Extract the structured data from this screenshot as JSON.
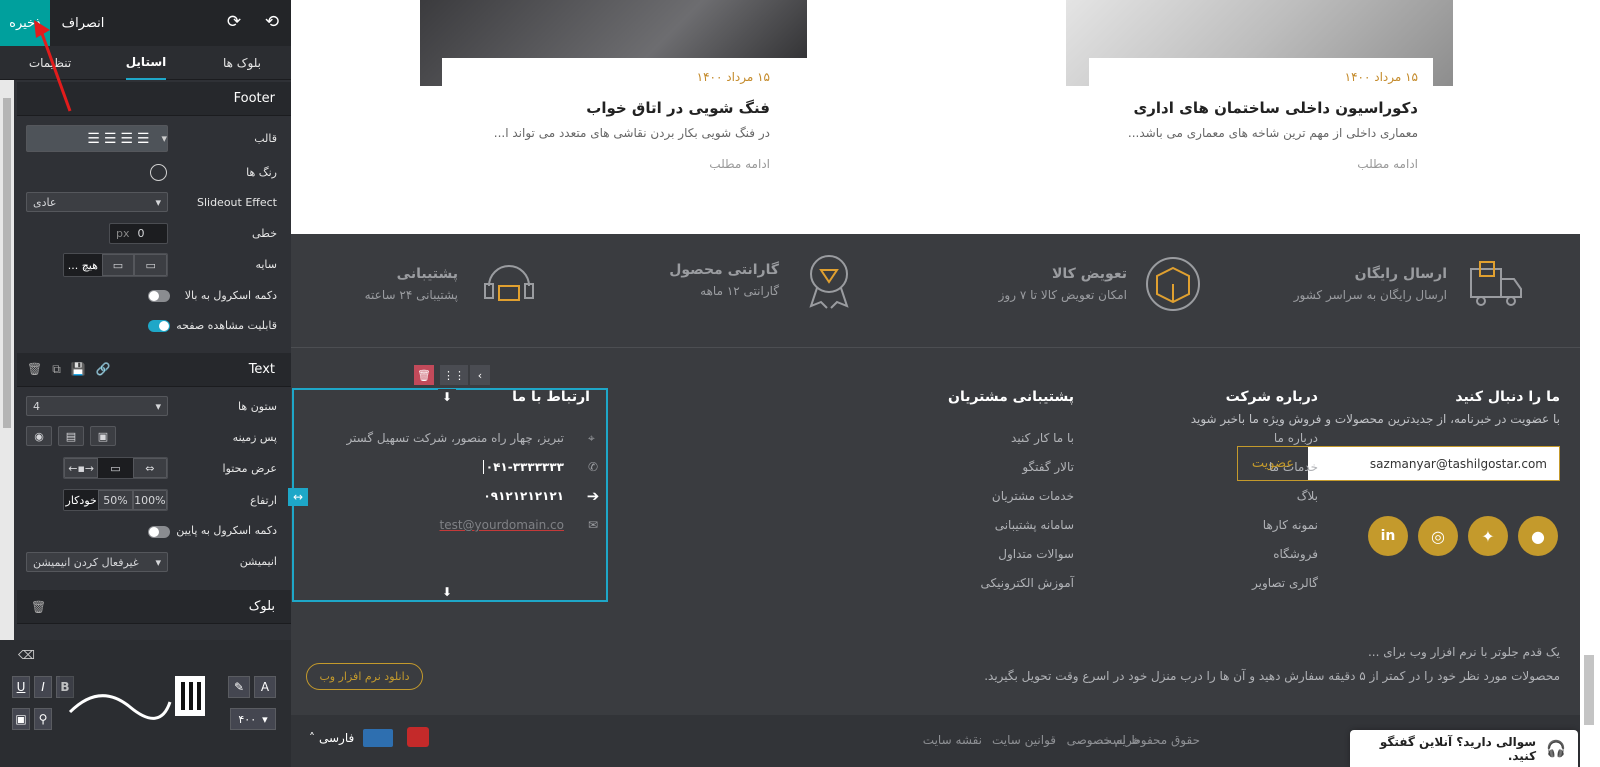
{
  "toolbar": {
    "save": "ذخیره",
    "cancel": "انصراف"
  },
  "tabs": {
    "blocks": "بلوک ها",
    "style": "استایل",
    "settings": "تنظیمات"
  },
  "footer_section": {
    "title": "Footer",
    "template": "قالب",
    "colors": "رنگ ها",
    "slideout": "Slideout Effect",
    "slideout_value": "عادی",
    "line": "خطی",
    "px": "px",
    "line_value": "0",
    "shadow": "سایه",
    "shadow_none": "هیچ ...",
    "scroll_top": "دکمه اسکرول به بالا",
    "page_visibility": "قابلیت مشاهده صفحه"
  },
  "text_section": {
    "title": "Text",
    "columns": "ستون ها",
    "columns_value": "4",
    "background": "پس زمینه",
    "content_width": "عرض محتوا",
    "height": "ارتفاع",
    "h_auto": "خودکار",
    "h_50": "50%",
    "h_100": "100%",
    "scroll_bottom": "دکمه اسکرول به پایین",
    "animation": "انیمیشن",
    "animation_value": "غیرفعال کردن انیمیشن"
  },
  "block_section": {
    "title": "بلوک"
  },
  "toolbar_fontsize": "۴۰۰",
  "cards": [
    {
      "date": "۱۵ مرداد ۱۴۰۰",
      "title": "فنگ شویی در اتاق خواب",
      "desc": "در فنگ شویی بکار بردن نقاشی های متعدد می تواند ا...",
      "more": "ادامه مطلب"
    },
    {
      "date": "۱۵ مرداد ۱۴۰۰",
      "title": "دکوراسیون داخلی ساختمان های اداری",
      "desc": "معماری داخلی از مهم ترین شاخه های معماری می باشد...",
      "more": "ادامه مطلب"
    }
  ],
  "features": [
    {
      "title": "ارسال رایگان",
      "sub": "ارسال رایگان به سراسر کشور"
    },
    {
      "title": "تعویض کالا",
      "sub": "امکان تعویض کالا تا ۷ روز"
    },
    {
      "title": "گارانتی محصول",
      "sub": "گارانتی ۱۲ ماهه"
    },
    {
      "title": "پشتیبانی",
      "sub": "پشتیبانی ۲۴ ساعته"
    }
  ],
  "follow": {
    "title": "ما را دنبال کنید",
    "desc": "با عضویت در خبرنامه، از جدیدترین محصولات و فروش ویژه ما باخبر شوید",
    "email": "sazmanyar@tashilgostar.com",
    "subscribe": "عضویت"
  },
  "about": {
    "title": "درباره شرکت",
    "links": [
      "درباره ما",
      "خدمات ما",
      "بلاگ",
      "نمونه کارها",
      "فروشگاه",
      "گالری تصاویر"
    ]
  },
  "support": {
    "title": "پشتیبانی مشتریان",
    "links": [
      "با ما کار کنید",
      "تالار گفتگو",
      "خدمات مشتریان",
      "سامانه پشتیبانی",
      "سوالات متداول",
      "آموزش الکترونیکی"
    ]
  },
  "contact": {
    "title": "ارتباط با ما",
    "address": "تبریز، چهار راه منصور، شرکت تسهیل گستر",
    "phone": "۰۴۱-۳۳۳۳۳۳۳",
    "mobile": "۰۹۱۲۱۲۱۲۱۲۱",
    "email": "test@yourdomain.co"
  },
  "promo": {
    "line1": "یک قدم جلوتر با نرم افزار وب برای ...",
    "line2": "محصولات مورد نظر خود را در کمتر از ۵ دقیقه سفارش دهید و آن ها را درب منزل خود در اسرع وقت تحویل بگیرید.",
    "download": "دانلود نرم افزار وب"
  },
  "bottom": {
    "rights": "حقوق محفوظ است.",
    "privacy": "حریم خصوصی",
    "rules": "قوانین سایت",
    "sitemap": "نقشه سایت",
    "lang": "فارسی",
    "chat": "سوالی دارید؟ آنلاین گفتگو کنید."
  },
  "colors": {
    "accent": "#00a09d",
    "gold": "#c49a2c",
    "footer": "#3a3c40"
  }
}
